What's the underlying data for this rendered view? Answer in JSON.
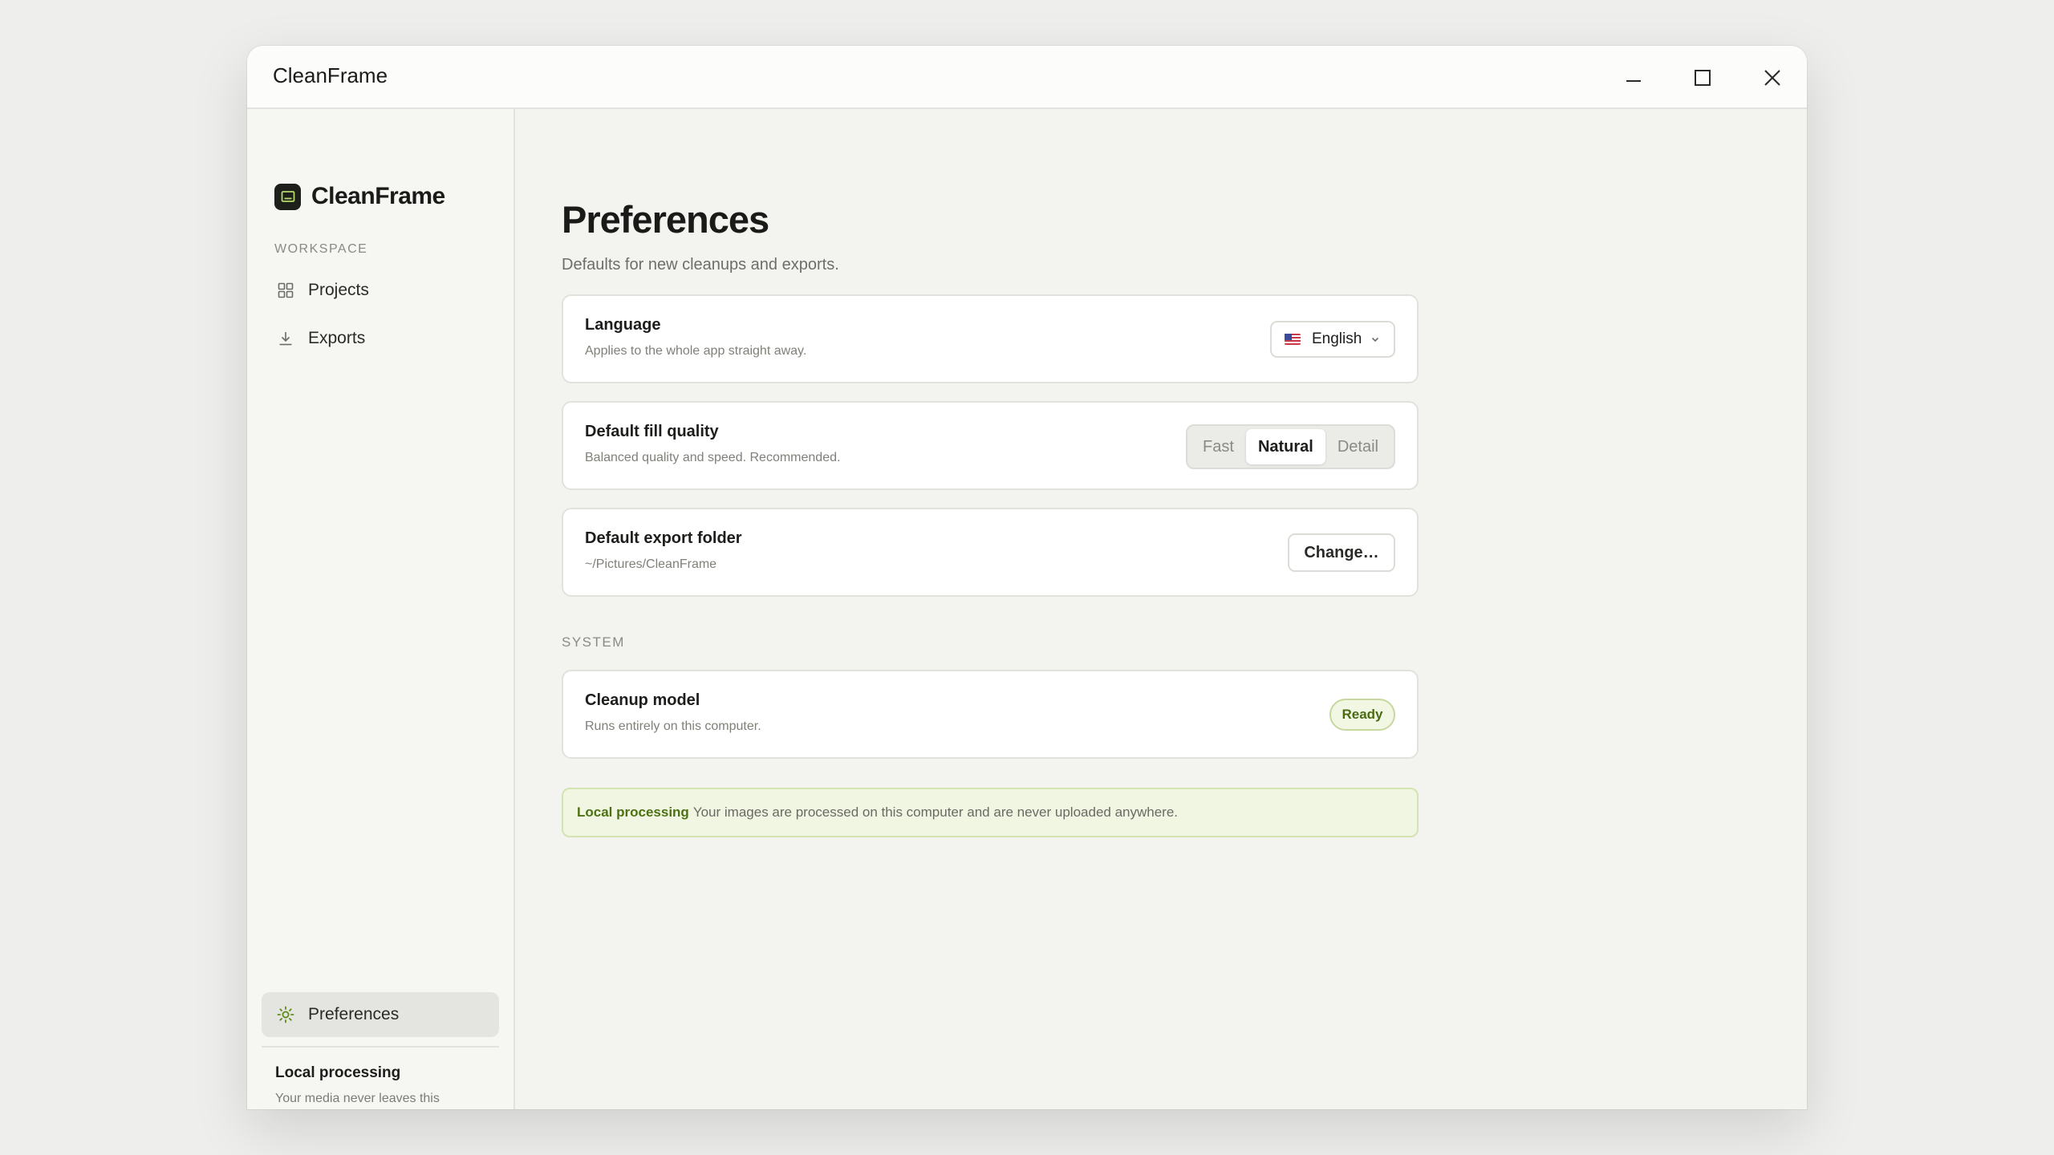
{
  "window": {
    "title": "CleanFrame",
    "controls": [
      "minimize-icon",
      "maximize-icon",
      "close-icon"
    ]
  },
  "sidebar": {
    "brand": "CleanFrame",
    "section_label": "WORKSPACE",
    "items": [
      {
        "label": "Projects",
        "icon": "grid-icon"
      },
      {
        "label": "Exports",
        "icon": "download-icon"
      }
    ],
    "bottom_item": {
      "label": "Preferences",
      "icon": "sun-gear-icon",
      "active": true
    },
    "footer": {
      "title": "Local processing",
      "text": "Your media never leaves this computer."
    }
  },
  "main": {
    "title": "Preferences",
    "subtitle": "Defaults for new cleanups and exports.",
    "language": {
      "title": "Language",
      "description": "Applies to the whole app straight away.",
      "value": "English",
      "flag": "us-flag-icon"
    },
    "fill_quality": {
      "title": "Default fill quality",
      "description": "Balanced quality and speed. Recommended.",
      "options": [
        "Fast",
        "Natural",
        "Detail"
      ],
      "selected": "Natural"
    },
    "export_folder": {
      "title": "Default export folder",
      "path": "~/Pictures/CleanFrame",
      "button": "Change…"
    },
    "system_label": "SYSTEM",
    "cleanup_model": {
      "title": "Cleanup model",
      "description": "Runs entirely on this computer.",
      "status": "Ready"
    },
    "notice": {
      "strong": "Local processing",
      "text": "Your images are processed on this computer and are never uploaded anywhere."
    }
  },
  "colors": {
    "accent": "#4d7113",
    "badge_bg": "#f2f7e4",
    "notice_bg": "#f1f6e2",
    "window_bg": "#f3f3f0"
  }
}
